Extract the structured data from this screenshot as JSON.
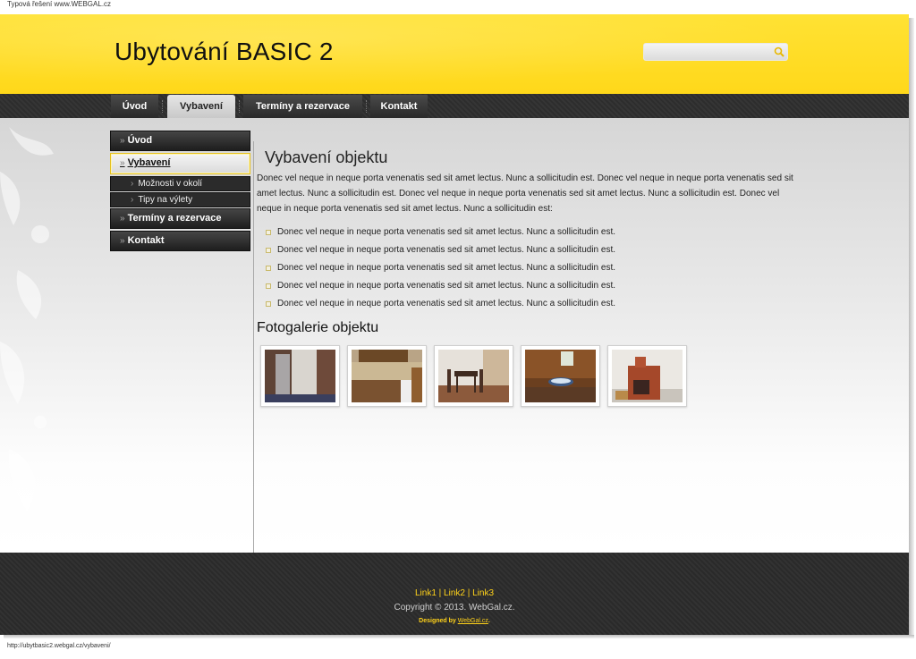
{
  "top_caption": "Typová řešení www.WEBGAL.cz",
  "header": {
    "title": "Ubytování BASIC 2",
    "search_placeholder": ""
  },
  "nav": [
    {
      "label": "Úvod"
    },
    {
      "label": "Vybavení"
    },
    {
      "label": "Termíny a rezervace"
    },
    {
      "label": "Kontakt"
    }
  ],
  "sidemenu": {
    "uvod": "Úvod",
    "vybaveni": "Vybavení",
    "sub1": "Možnosti v okolí",
    "sub2": "Tipy na výlety",
    "terminy": "Termíny a rezervace",
    "kontakt": "Kontakt"
  },
  "main": {
    "title": "Vybavení objektu",
    "paragraph": "Donec vel neque in neque porta venenatis sed sit amet lectus. Nunc a sollicitudin est.  Donec vel neque in neque porta venenatis sed sit amet lectus. Nunc a sollicitudin est. Donec vel neque in neque porta venenatis sed sit amet lectus. Nunc a sollicitudin est. Donec vel neque in neque porta venenatis sed sit amet lectus. Nunc a sollicitudin est:",
    "bullets": [
      "Donec vel neque in neque porta venenatis sed sit amet lectus. Nunc a sollicitudin est.",
      "Donec vel neque in neque porta venenatis sed sit amet lectus. Nunc a sollicitudin est.",
      "Donec vel neque in neque porta venenatis sed sit amet lectus. Nunc a sollicitudin est.",
      "Donec vel neque in neque porta venenatis sed sit amet lectus. Nunc a sollicitudin est.",
      "Donec vel neque in neque porta venenatis sed sit amet lectus. Nunc a sollicitudin est."
    ],
    "gallery_title": "Fotogalerie objektu"
  },
  "footer": {
    "link1": "Link1",
    "link2": "Link2",
    "link3": "Link3",
    "sep": "|",
    "copyright": "Copyright © 2013. WebGal.cz.",
    "designed_by": "Designed by",
    "designed_link": "WebGal.cz"
  },
  "status_url": "http://ubytbasic2.webgal.cz/vybaveni/",
  "colors": {
    "accent": "#ffd81a",
    "dark": "#2d2d2d"
  }
}
